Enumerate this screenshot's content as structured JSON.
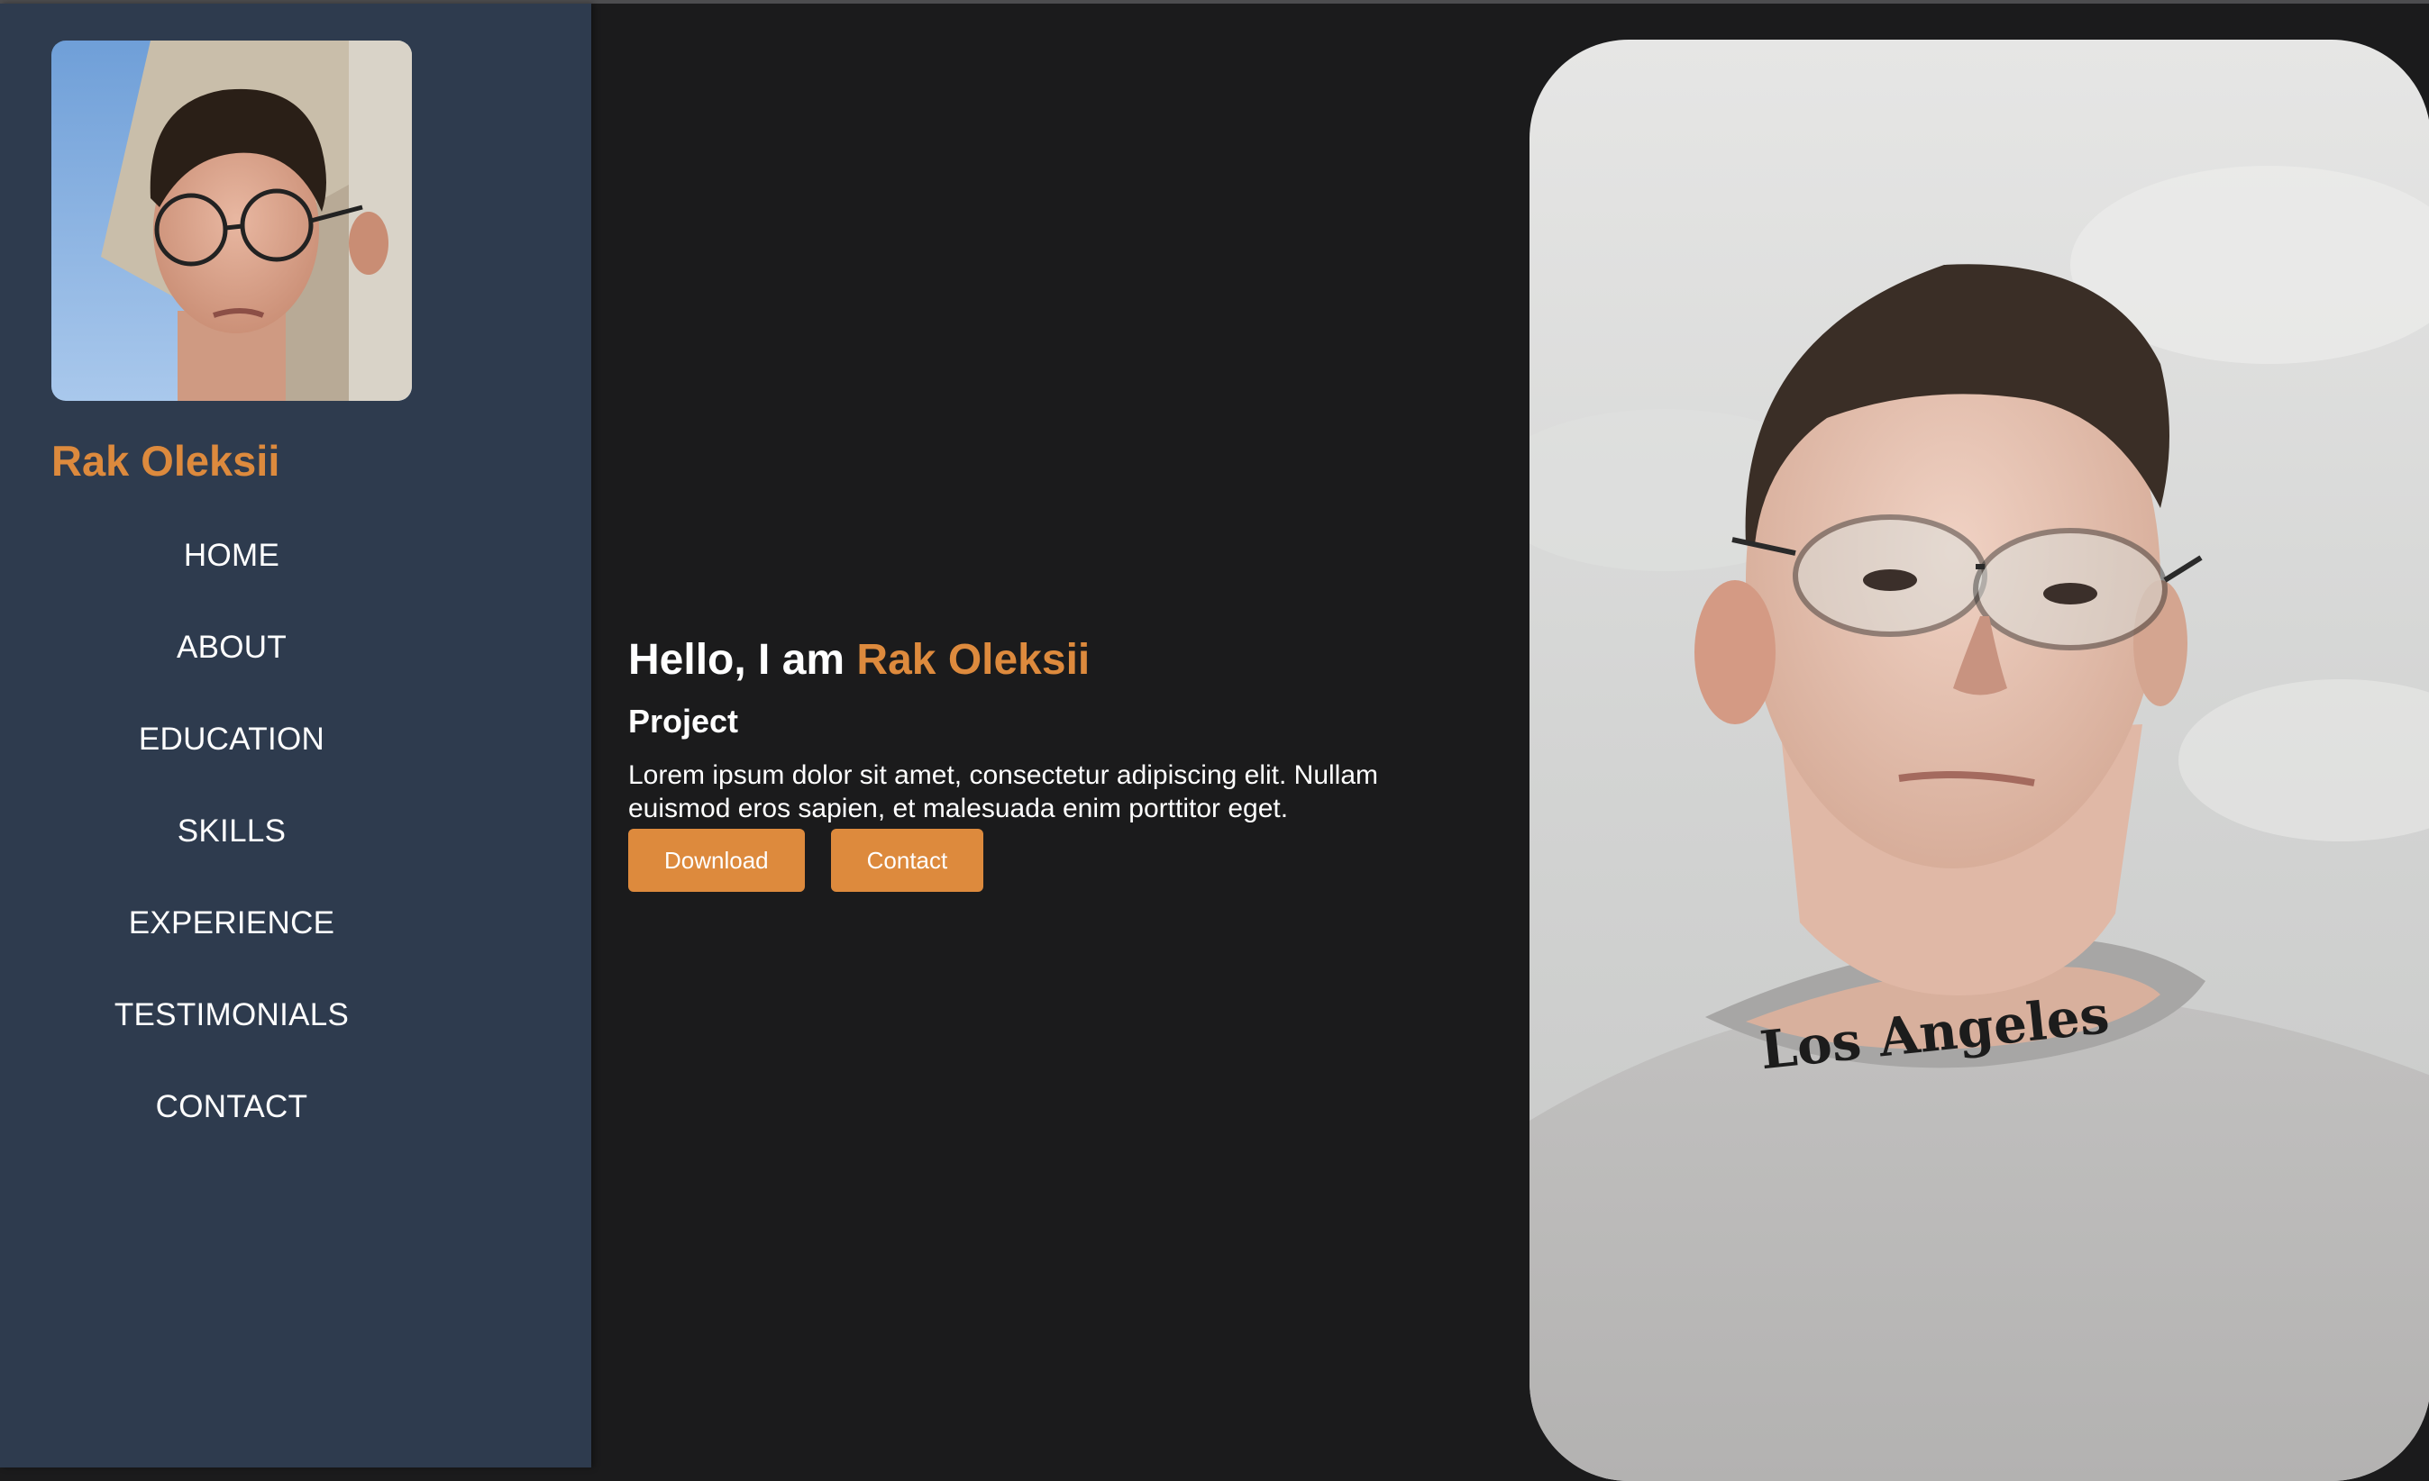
{
  "sidebar": {
    "name": "Rak Oleksii",
    "nav": [
      "HOME",
      "ABOUT",
      "EDUCATION",
      "SKILLS",
      "EXPERIENCE",
      "TESTIMONIALS",
      "CONTACT"
    ]
  },
  "hero": {
    "greeting": "Hello, I am",
    "name": "Rak Oleksii",
    "subtitle": "Project",
    "description": "Lorem ipsum dolor sit amet, consectetur adipiscing elit. Nullam euismod eros sapien, et malesuada enim porttitor eget.",
    "download_label": "Download",
    "contact_label": "Contact"
  },
  "portrait": {
    "sweater_print": "Los Angeles"
  },
  "colors": {
    "accent": "#dd8a3d",
    "sidebar_bg": "#2e3b4e",
    "page_bg": "#1b1b1c"
  }
}
